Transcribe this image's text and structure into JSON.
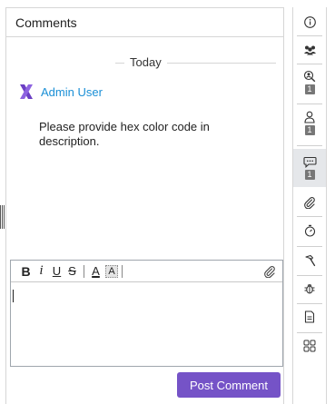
{
  "panel": {
    "title": "Comments"
  },
  "thread": {
    "day_label": "Today",
    "comments": [
      {
        "author": "Admin User",
        "text": "Please provide hex color code in description."
      }
    ]
  },
  "editor": {
    "toolbar": {
      "bold": "B",
      "italic": "i",
      "underline": "U",
      "strike": "S",
      "font_color": "A",
      "highlight": "A"
    }
  },
  "actions": {
    "post_label": "Post Comment"
  },
  "sidebar": {
    "items": [
      {
        "icon": "info-icon"
      },
      {
        "icon": "users-icon"
      },
      {
        "icon": "watcher-search-icon",
        "badge": "1"
      },
      {
        "icon": "user-icon",
        "badge": "1"
      },
      {
        "icon": "comments-icon",
        "badge": "1",
        "active": true
      },
      {
        "icon": "paperclip-icon"
      },
      {
        "icon": "stopwatch-icon"
      },
      {
        "icon": "hammer-icon"
      },
      {
        "icon": "bug-icon"
      },
      {
        "icon": "document-icon"
      },
      {
        "icon": "grid-icon"
      }
    ]
  },
  "colors": {
    "accent": "#7553c7",
    "link": "#1a8fd6",
    "badge": "#777777",
    "active_bg": "#e5e7ea"
  }
}
